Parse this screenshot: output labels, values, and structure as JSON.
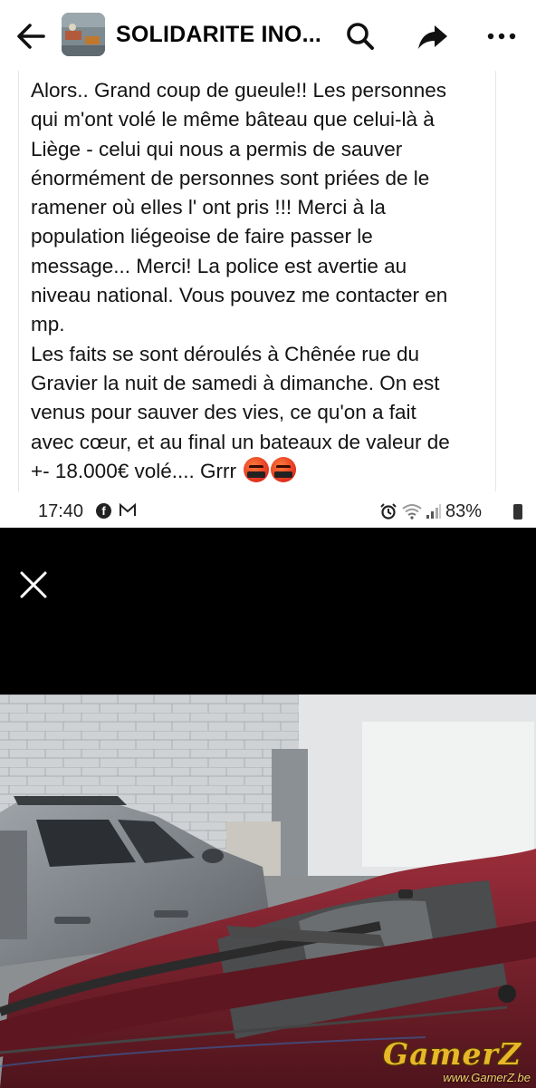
{
  "header": {
    "title": "SOLIDARITE INO...",
    "back_icon": "arrow-left-icon",
    "search_icon": "search-icon",
    "share_icon": "share-icon",
    "more_icon": "more-horizontal-icon"
  },
  "post": {
    "text": "Alors..  Grand coup de gueule!!  Les personnes\nqui m'ont volé le même bâteau que celui-là à\nLiège -  celui qui nous a  permis de sauver\nénormément de personnes sont priées de le\nramener où elles l' ont pris !!! Merci à la\npopulation liégeoise de faire passer le\nmessage...  Merci! La police est avertie au\nniveau national. Vous pouvez me contacter en\nmp.\nLes faits se sont déroulés à Chênée rue du\nGravier la nuit de samedi à dimanche. On est\nvenus pour sauver des vies, ce qu'on a fait\navec cœur, et au final un bateaux de valeur de",
    "last_line": "+- 18.000€ volé.... Grrr",
    "emoji_icon": "angry-cursing-face-icon"
  },
  "embedded_screenshot": {
    "status_time": "17:40",
    "status_battery": "83%",
    "close_icon": "close-icon"
  },
  "watermark": {
    "brand": "GamerZ",
    "url": "www.GamerZ.be"
  },
  "colors": {
    "watermark_gold": "#e9b62a",
    "boat_red": "#7a1f2b"
  }
}
